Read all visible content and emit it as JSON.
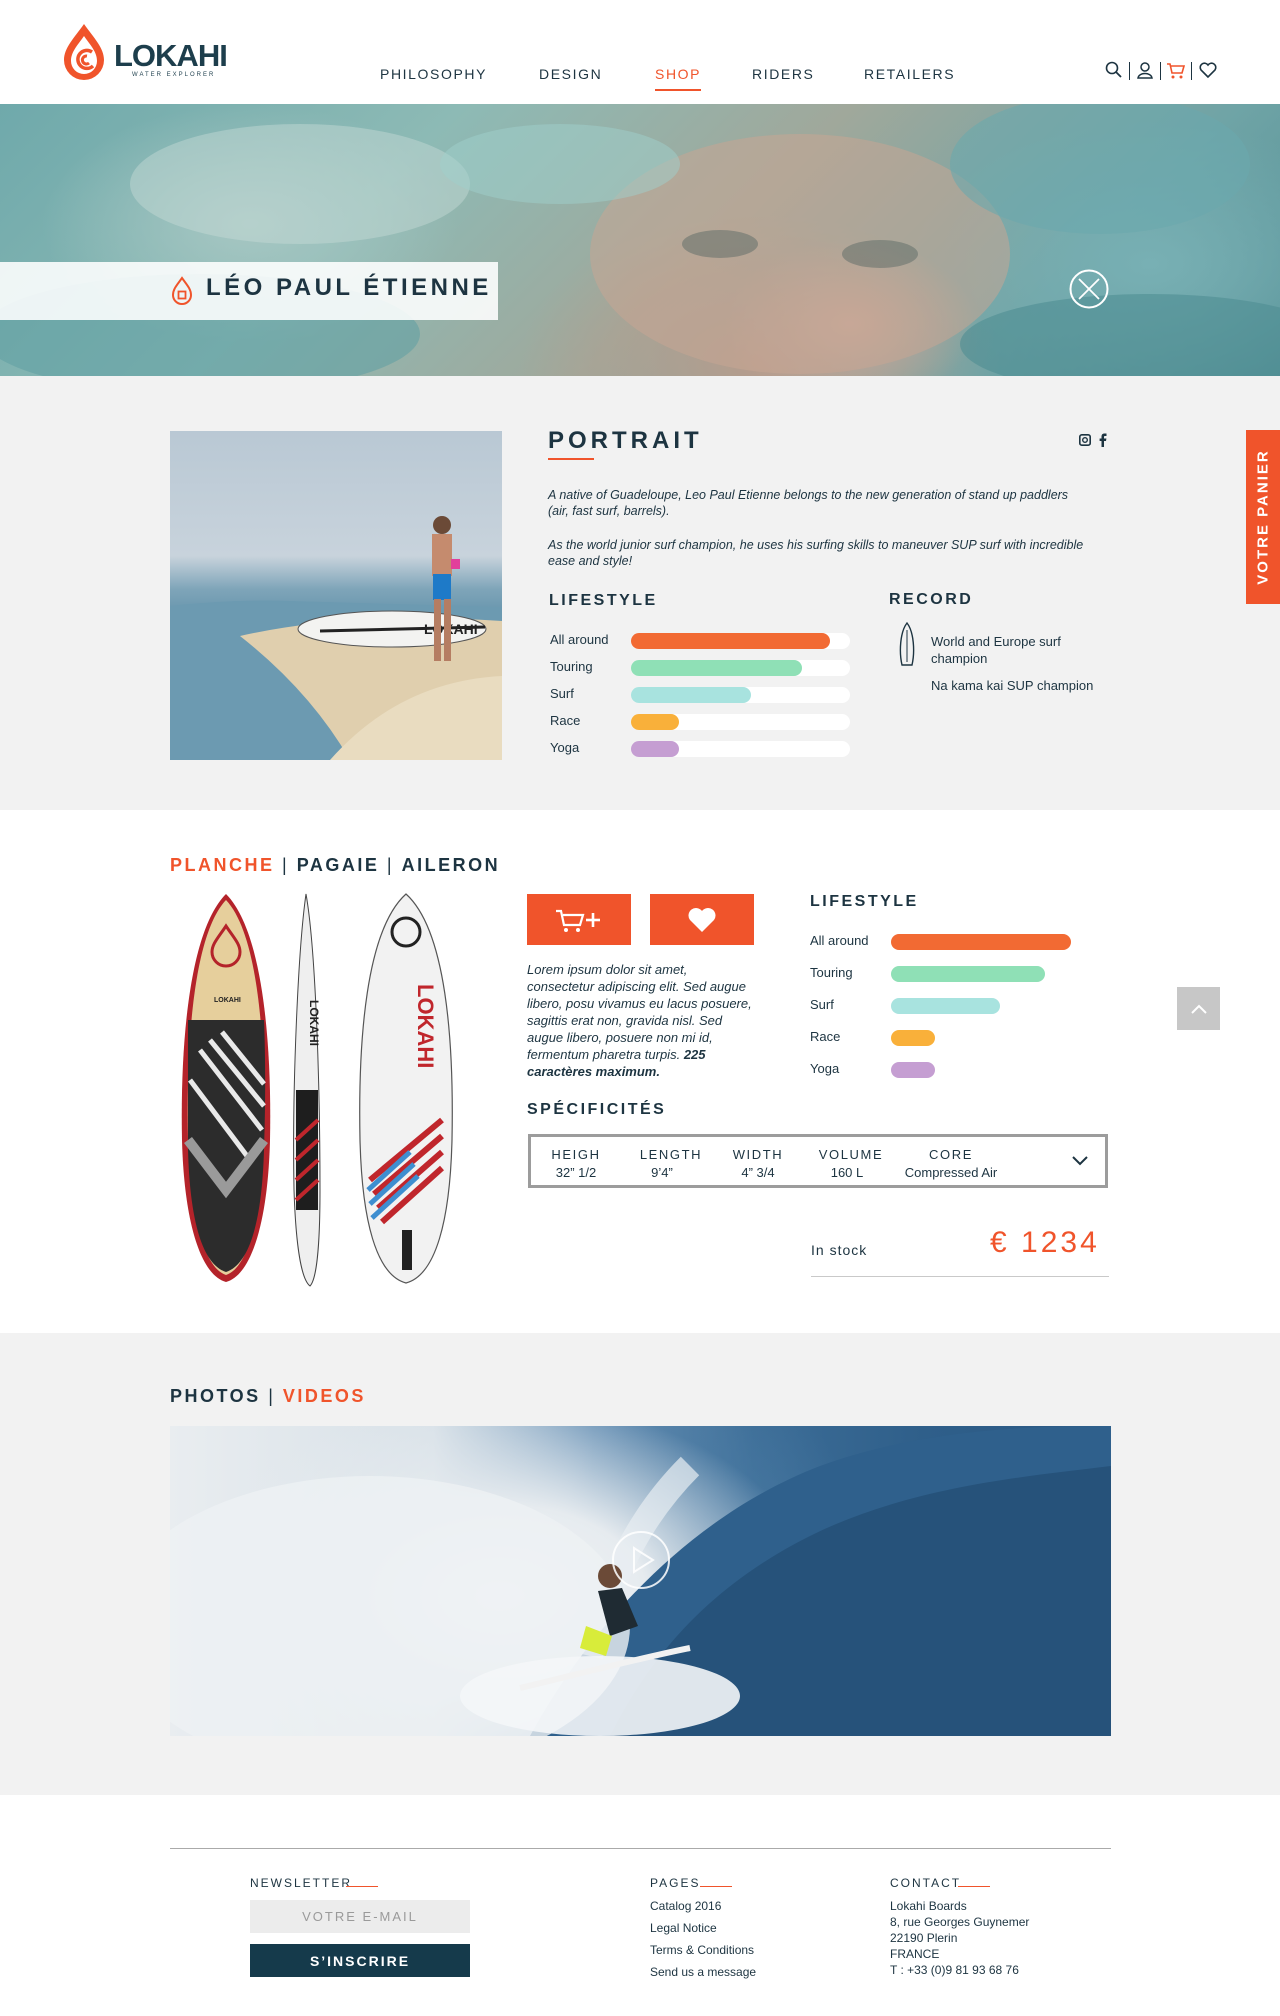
{
  "colors": {
    "accent": "#f0542b",
    "dark": "#1d3441",
    "all_around": "#f26a33",
    "touring": "#8fe0b6",
    "surf": "#a8e3df",
    "race": "#f9b03a",
    "yoga": "#c59ed2"
  },
  "logo": {
    "name": "LOKAHI",
    "tagline": "WATER EXPLORER"
  },
  "nav": {
    "items": [
      {
        "label": "PHILOSOPHY"
      },
      {
        "label": "DESIGN"
      },
      {
        "label": "SHOP"
      },
      {
        "label": "RIDERS"
      },
      {
        "label": "RETAILERS"
      }
    ],
    "active": "SHOP"
  },
  "header_icons": [
    "search-icon",
    "user-icon",
    "cart-icon",
    "heart-icon"
  ],
  "hero": {
    "name": "LÉO PAUL ÉTIENNE"
  },
  "portrait": {
    "title": "PORTRAIT",
    "social": [
      "instagram-icon",
      "facebook-icon"
    ],
    "paragraphs": [
      "A native of Guadeloupe, Leo Paul Etienne belongs to the new generation of stand up paddlers (air, fast surf, barrels).",
      "As the world junior surf champion, he uses his surfing skills to maneuver SUP surf with incredible ease and style!"
    ],
    "lifestyle_title": "LIFESTYLE",
    "lifestyle": [
      {
        "label": "All around",
        "value": 0.91
      },
      {
        "label": "Touring",
        "value": 0.78
      },
      {
        "label": "Surf",
        "value": 0.55
      },
      {
        "label": "Race",
        "value": 0.22
      },
      {
        "label": "Yoga",
        "value": 0.22
      }
    ],
    "record_title": "RECORD",
    "records": [
      "World and Europe surf champion",
      "Na kama kai SUP champion"
    ]
  },
  "side_cart": {
    "label": "VOTRE PANIER"
  },
  "product": {
    "tabs": [
      "PLANCHE",
      "PAGAIE",
      "AILERON"
    ],
    "active_tab": "PLANCHE",
    "board_text": "LOKAHI",
    "description": "Lorem ipsum dolor sit amet, consectetur adipiscing elit. Sed augue libero, posu vivamus eu lacus posuere, sagittis erat non, gravida nisl. Sed augue libero, posuere non mi id, fermentum pharetra turpis.",
    "description_strong": "225 caractères maximum.",
    "lifestyle_title": "LIFESTYLE",
    "lifestyle": [
      {
        "label": "All around",
        "value": 0.91
      },
      {
        "label": "Touring",
        "value": 0.78
      },
      {
        "label": "Surf",
        "value": 0.55
      },
      {
        "label": "Race",
        "value": 0.22
      },
      {
        "label": "Yoga",
        "value": 0.22
      }
    ],
    "spec_title": "SPÉCIFICITÉS",
    "specs": [
      {
        "label": "HEIGH",
        "value": "32” 1/2"
      },
      {
        "label": "LENGTH",
        "value": "9’4”"
      },
      {
        "label": "WIDTH",
        "value": "4” 3/4"
      },
      {
        "label": "VOLUME",
        "value": "160 L"
      },
      {
        "label": "CORE",
        "value": "Compressed Air"
      }
    ],
    "stock": "In stock",
    "price": "€ 1234"
  },
  "media": {
    "tabs": [
      "PHOTOS",
      "VIDEOS"
    ],
    "active_tab": "VIDEOS"
  },
  "footer": {
    "newsletter": {
      "title": "NEWSLETTER",
      "placeholder": "VOTRE E-MAIL",
      "button": "S’INSCRIRE"
    },
    "pages": {
      "title": "PAGES",
      "links": [
        "Catalog 2016",
        "Legal Notice",
        "Terms & Conditions",
        "Send us a message"
      ]
    },
    "contact": {
      "title": "CONTACT",
      "lines": [
        "Lokahi Boards",
        "8, rue Georges Guynemer",
        "22190 Plerin",
        "FRANCE",
        "T : +33 (0)9 81 93 68 76"
      ]
    }
  }
}
